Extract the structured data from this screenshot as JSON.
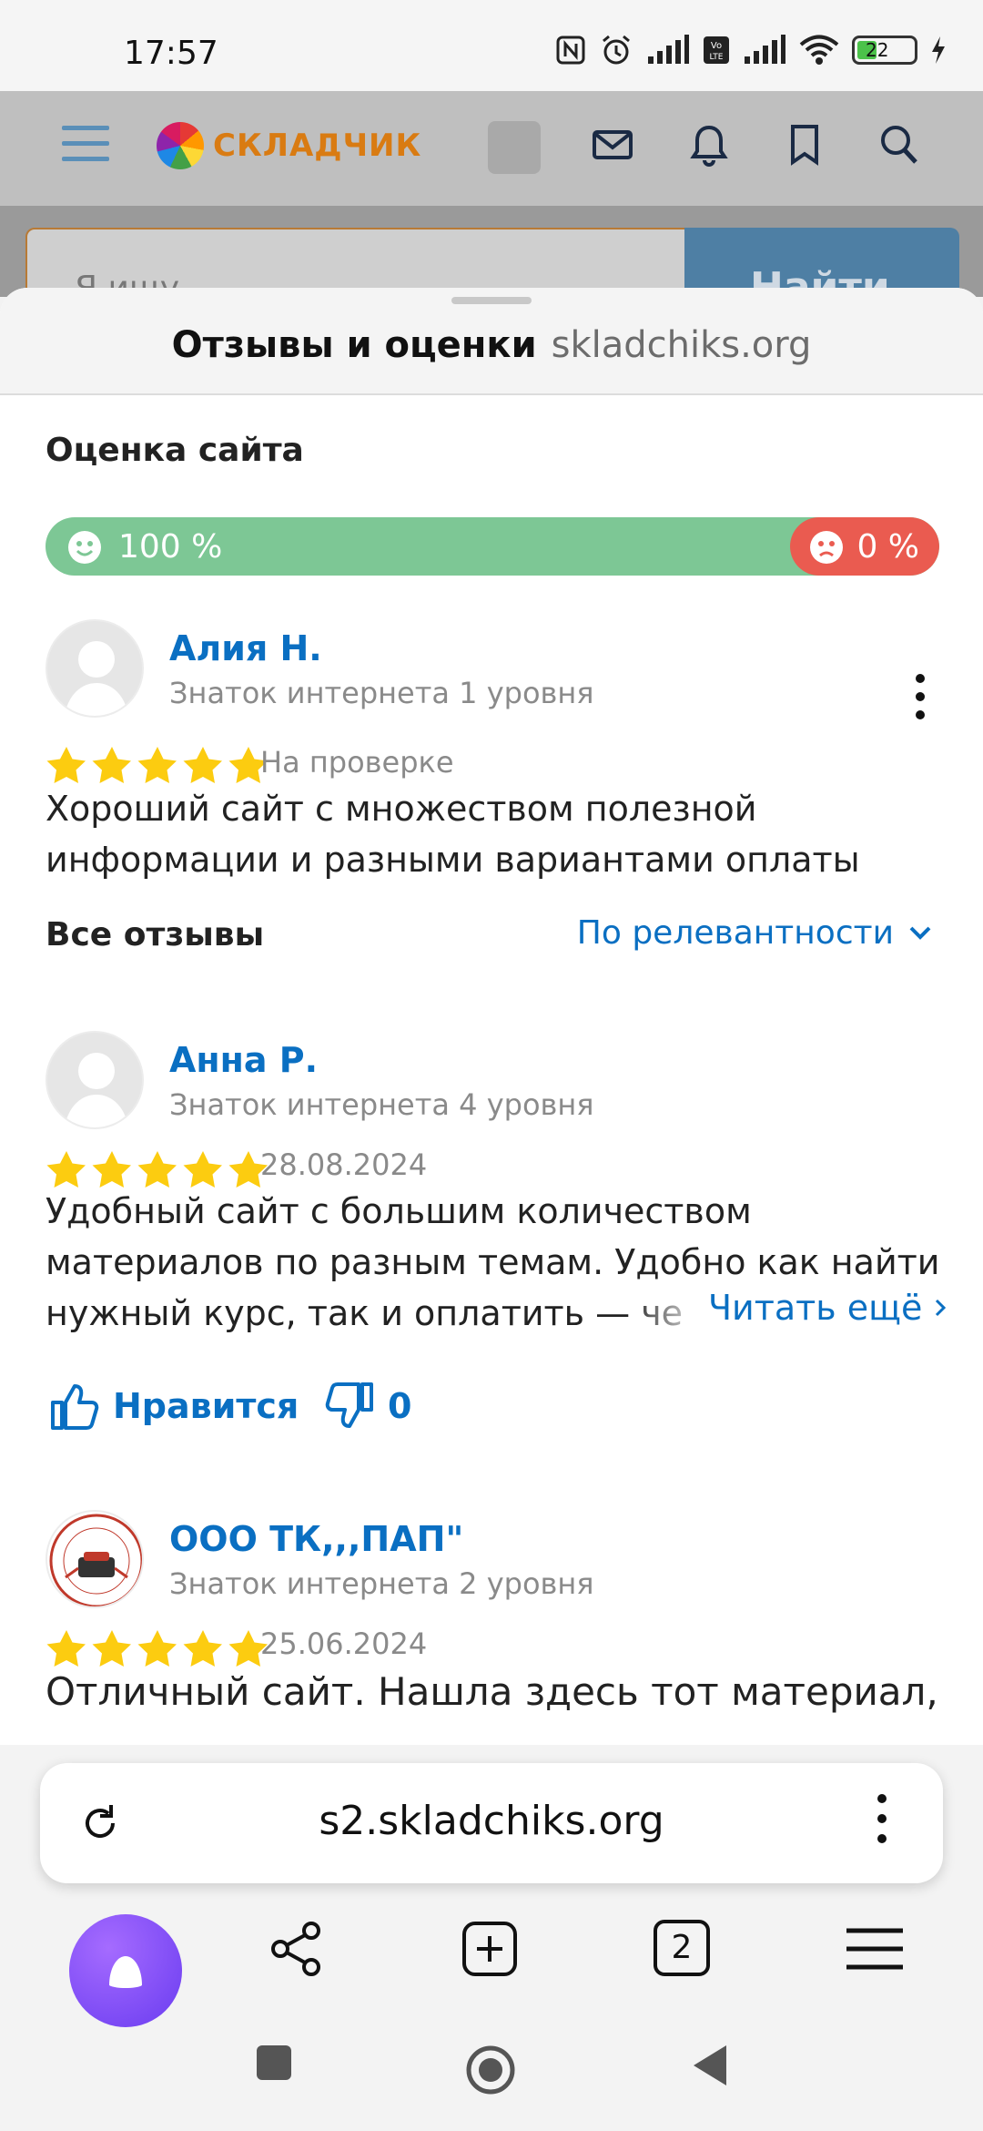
{
  "status_bar": {
    "time": "17:57",
    "battery": "22"
  },
  "site": {
    "logo_text": "СКЛАДЧИК",
    "search_placeholder": "Я ищу...",
    "search_button": "Найти"
  },
  "sheet": {
    "title": "Отзывы и оценки",
    "domain": "skladchiks.org"
  },
  "site_rating": {
    "heading": "Оценка сайта",
    "positive": "100 %",
    "negative": "0 %",
    "positive_share": 1.0
  },
  "my_review": {
    "name": "Алия Н.",
    "level": "Знаток интернета 1 уровня",
    "stars": 5,
    "status": "На проверке",
    "text_line1": "Хороший сайт с множеством полезной",
    "text_line2": "информации и разными вариантами оплаты"
  },
  "all_reviews": {
    "heading": "Все отзывы",
    "sort_label": "По релевантности"
  },
  "reviews": [
    {
      "name": "Анна Р.",
      "level": "Знаток интернета 4 уровня",
      "stars": 5,
      "date": "28.08.2024",
      "text_line1": "Удобный сайт с большим количеством",
      "text_line2": "материалов по разным темам. Удобно как найти",
      "text_line3": "нужный курс, так и оплатить — через",
      "read_more": "Читать ещё",
      "like_label": "Нравится",
      "dislike_count": "0"
    },
    {
      "name": "ООО ТК,,,ПАП\"",
      "level": "Знаток интернета 2 уровня",
      "stars": 5,
      "date": "25.06.2024",
      "text_line1": "Отличный сайт. Нашла здесь тот материал,"
    }
  ],
  "browser": {
    "url": "s2.skladchiks.org",
    "tabs_count": "2"
  },
  "colors": {
    "link": "#0a6fc2",
    "positive": "#7dc795",
    "negative": "#ea5b50",
    "star": "#fccc10"
  }
}
